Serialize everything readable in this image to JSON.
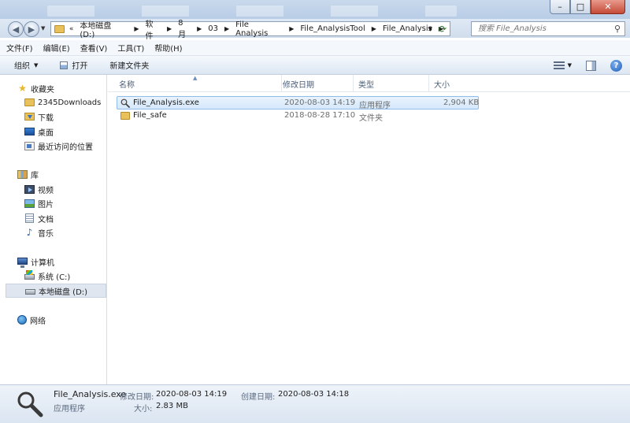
{
  "window": {
    "minimize_glyph": "–",
    "maximize_glyph": "□",
    "close_glyph": "✕"
  },
  "address_bar": {
    "chevrons": "«",
    "breadcrumbs": [
      "本地磁盘 (D:)",
      "软件",
      "8月",
      "03",
      "File Analysis",
      "File_AnalysisTool",
      "File_Analysis"
    ]
  },
  "search": {
    "placeholder": "搜索 File_Analysis"
  },
  "menubar": {
    "items": [
      "文件(F)",
      "编辑(E)",
      "查看(V)",
      "工具(T)",
      "帮助(H)"
    ]
  },
  "toolbar": {
    "organize": "组织",
    "open": "打开",
    "new_folder": "新建文件夹"
  },
  "navpane": {
    "favorites": "收藏夹",
    "downloads_2345": "2345Downloads",
    "downloads": "下载",
    "desktop": "桌面",
    "recent": "最近访问的位置",
    "libraries": "库",
    "videos": "视频",
    "pictures": "图片",
    "documents": "文档",
    "music": "音乐",
    "computer": "计算机",
    "drive_c": "系统 (C:)",
    "drive_d": "本地磁盘 (D:)",
    "network": "网络"
  },
  "columns": {
    "name": "名称",
    "modified": "修改日期",
    "type": "类型",
    "size": "大小"
  },
  "files": [
    {
      "name": "File_Analysis.exe",
      "modified": "2020-08-03 14:19",
      "type": "应用程序",
      "size": "2,904 KB",
      "icon": "magnifier-icon"
    },
    {
      "name": "File_safe",
      "modified": "2018-08-28 17:10",
      "type": "文件夹",
      "size": "",
      "icon": "folder-icon"
    }
  ],
  "details": {
    "name": "File_Analysis.exe",
    "type": "应用程序",
    "modified_label": "修改日期:",
    "modified_value": "2020-08-03 14:19",
    "created_label": "创建日期:",
    "created_value": "2020-08-03 14:18",
    "size_label": "大小:",
    "size_value": "2.83 MB"
  }
}
